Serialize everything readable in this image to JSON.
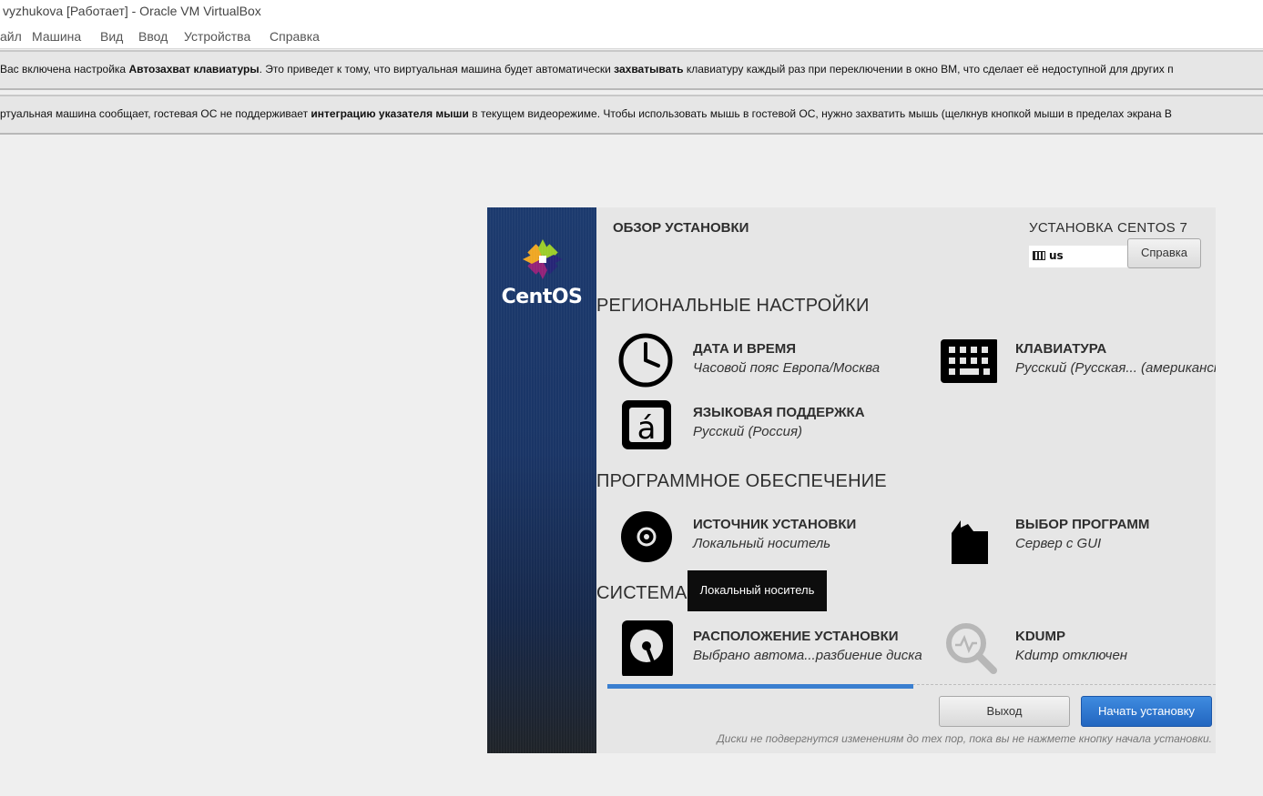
{
  "window": {
    "title": "vyzhukova [Работает] - Oracle VM VirtualBox"
  },
  "menu": {
    "items": [
      "айл",
      "Машина",
      "Вид",
      "Ввод",
      "Устройства",
      "Справка"
    ]
  },
  "notices": {
    "keyboard": {
      "t1": "Вас включена настройка ",
      "b1": "Автозахват клавиатуры",
      "t2": ". Это приведет к тому, что виртуальная машина будет автоматически ",
      "b2": "захватывать",
      "t3": " клавиатуру каждый раз при переключении в окно ВМ, что сделает её недоступной для других п"
    },
    "mouse": {
      "t1": "ртуальная машина сообщает, гостевая ОС не поддерживает ",
      "b1": "интеграцию указателя мыши",
      "t2": " в текущем видеорежиме. Чтобы использовать мышь в гостевой ОС, нужно захватить мышь (щелкнув кнопкой мыши в пределах экрана В"
    }
  },
  "installer": {
    "brand": "CentOS",
    "header_left": "ОБЗОР УСТАНОВКИ",
    "header_right": "УСТАНОВКА CENTOS 7",
    "keyboard_layout": "us",
    "help_label": "Справка",
    "sections": {
      "regional": "РЕГИОНАЛЬНЫЕ НАСТРОЙКИ",
      "software": "ПРОГРАММНОЕ ОБЕСПЕЧЕНИЕ",
      "system": "СИСТЕМА"
    },
    "spokes": {
      "datetime": {
        "title": "ДАТА И ВРЕМЯ",
        "status": "Часовой пояс Европа/Москва"
      },
      "keyboard": {
        "title": "КЛАВИАТУРА",
        "status": "Русский (Русская... (американска"
      },
      "language": {
        "title": "ЯЗЫКОВАЯ ПОДДЕРЖКА",
        "status": "Русский (Россия)"
      },
      "source": {
        "title": "ИСТОЧНИК УСТАНОВКИ",
        "status": "Локальный носитель"
      },
      "software": {
        "title": "ВЫБОР ПРОГРАММ",
        "status": "Сервер с GUI"
      },
      "destination": {
        "title": "РАСПОЛОЖЕНИЕ УСТАНОВКИ",
        "status": "Выбрано автома...разбиение диска"
      },
      "kdump": {
        "title": "KDUMP",
        "status": "Kdump отключен"
      }
    },
    "tooltip": "Локальный носитель",
    "quit_label": "Выход",
    "begin_label": "Начать установку",
    "disk_note": "Диски не подвергнутся изменениям до тех пор, пока вы не нажмете кнопку начала установки.",
    "accent_color": "#2a72c8"
  }
}
